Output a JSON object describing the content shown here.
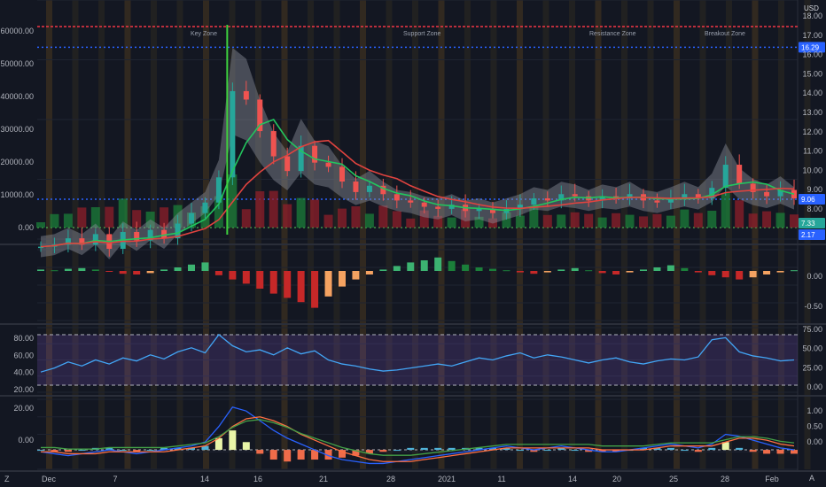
{
  "currency": "USD",
  "bottom_left_btn": "Z",
  "bottom_right_btn": "A",
  "chart_data": [
    {
      "type": "line",
      "pane": "price",
      "x": [
        "Dec",
        "7",
        "14",
        "16",
        "21",
        "28",
        "2021",
        "11",
        "14",
        "20",
        "25",
        "28",
        "Feb"
      ],
      "left_axis_ticks": [
        "60000.00",
        "50000.00",
        "40000.00",
        "30000.00",
        "20000.00",
        "10000.00",
        "0.00"
      ],
      "right_axis_ticks": [
        "18.00",
        "17.00",
        "16.00",
        "15.00",
        "14.00",
        "13.00",
        "12.00",
        "11.00",
        "10.00",
        "9.00",
        "8.00"
      ],
      "price_series": [
        6.8,
        6.9,
        7.2,
        6.9,
        7.4,
        6.7,
        7.5,
        7.1,
        7.6,
        7.2,
        7.9,
        8.4,
        8.9,
        10.1,
        14.2,
        13.8,
        12.3,
        11.1,
        10.4,
        11.6,
        10.8,
        10.6,
        9.9,
        9.4,
        9.7,
        9.3,
        9.0,
        8.9,
        8.7,
        8.6,
        8.8,
        8.5,
        8.6,
        8.4,
        8.6,
        8.8,
        9.1,
        9.0,
        9.3,
        9.2,
        9.0,
        9.2,
        9.1,
        9.3,
        9.0,
        8.9,
        9.1,
        9.3,
        9.1,
        9.6,
        10.7,
        9.8,
        9.4,
        9.2,
        9.5,
        9.1
      ],
      "price_labels": {
        "current": "9.06",
        "level_high": "16.29",
        "level_mid": "7.33",
        "level_low": "2.17"
      },
      "annotations": [
        "Key Zone",
        "Support Zone",
        "Resistance Zone",
        "Breakout Zone"
      ],
      "ylim_right": [
        7.5,
        18.2
      ]
    },
    {
      "type": "bar",
      "pane": "momentum",
      "right_axis_ticks": [
        "0.00",
        "-0.50"
      ],
      "values": [
        0.02,
        0.01,
        0.03,
        0.04,
        0.02,
        -0.01,
        -0.04,
        -0.05,
        -0.03,
        0.02,
        0.05,
        0.09,
        0.12,
        -0.06,
        -0.12,
        -0.18,
        -0.25,
        -0.32,
        -0.38,
        -0.44,
        -0.52,
        -0.36,
        -0.22,
        -0.12,
        -0.05,
        0.02,
        0.07,
        0.12,
        0.15,
        0.19,
        0.14,
        0.09,
        0.05,
        0.03,
        0.01,
        -0.02,
        -0.04,
        -0.02,
        0.02,
        0.04,
        0.01,
        -0.03,
        -0.05,
        -0.02,
        0.02,
        0.05,
        0.08,
        0.04,
        -0.02,
        -0.06,
        -0.09,
        -0.12,
        -0.09,
        -0.05,
        -0.02,
        0.01
      ],
      "ylim": [
        -0.7,
        0.3
      ]
    },
    {
      "type": "line",
      "pane": "rsi",
      "left_axis_ticks": [
        "80.00",
        "60.00",
        "40.00",
        "20.00"
      ],
      "right_axis_ticks": [
        "75.00",
        "50.00",
        "25.00",
        "0.00"
      ],
      "values": [
        38,
        42,
        48,
        44,
        50,
        46,
        52,
        49,
        55,
        51,
        58,
        62,
        57,
        75,
        64,
        58,
        60,
        55,
        62,
        56,
        59,
        50,
        46,
        44,
        41,
        39,
        40,
        42,
        44,
        46,
        44,
        48,
        52,
        50,
        54,
        57,
        52,
        55,
        53,
        50,
        47,
        50,
        52,
        48,
        46,
        49,
        51,
        50,
        53,
        70,
        72,
        58,
        54,
        52,
        49,
        50
      ],
      "bands": [
        75,
        25
      ],
      "ylim": [
        18,
        82
      ]
    },
    {
      "type": "line",
      "pane": "macd",
      "left_axis_ticks": [
        "20.00",
        "0.00"
      ],
      "right_axis_ticks": [
        "1.00",
        "0.50",
        "0.00"
      ],
      "macd_line": [
        -1,
        -2,
        -3,
        -2,
        -1,
        0,
        -1,
        -2,
        -1,
        0,
        1,
        2,
        4,
        12,
        22,
        20,
        15,
        10,
        6,
        3,
        0,
        -3,
        -5,
        -6,
        -7,
        -7,
        -6,
        -5,
        -4,
        -3,
        -2,
        -1,
        0,
        1,
        2,
        1,
        0,
        1,
        2,
        1,
        0,
        -1,
        -1,
        0,
        1,
        2,
        3,
        2,
        1,
        3,
        8,
        7,
        5,
        3,
        1,
        0
      ],
      "signal_line": [
        -1,
        -1,
        -2,
        -2,
        -2,
        -1,
        -1,
        -1,
        -1,
        -1,
        0,
        1,
        2,
        6,
        12,
        16,
        17,
        15,
        12,
        8,
        5,
        2,
        -1,
        -3,
        -5,
        -6,
        -6,
        -6,
        -5,
        -4,
        -3,
        -2,
        -1,
        0,
        1,
        1,
        1,
        1,
        1,
        1,
        1,
        0,
        0,
        0,
        0,
        1,
        2,
        2,
        2,
        2,
        4,
        6,
        6,
        5,
        3,
        2
      ],
      "histogram": [
        0,
        -1,
        -1,
        0,
        1,
        1,
        0,
        -1,
        0,
        1,
        1,
        1,
        2,
        6,
        10,
        4,
        -2,
        -5,
        -6,
        -5,
        -5,
        -5,
        -4,
        -3,
        -2,
        -1,
        0,
        1,
        1,
        1,
        1,
        1,
        1,
        1,
        1,
        0,
        -1,
        0,
        1,
        0,
        -1,
        -1,
        -1,
        0,
        1,
        1,
        1,
        0,
        -1,
        1,
        4,
        1,
        -1,
        -2,
        -2,
        -2
      ],
      "ylim": [
        -10,
        26
      ]
    }
  ]
}
